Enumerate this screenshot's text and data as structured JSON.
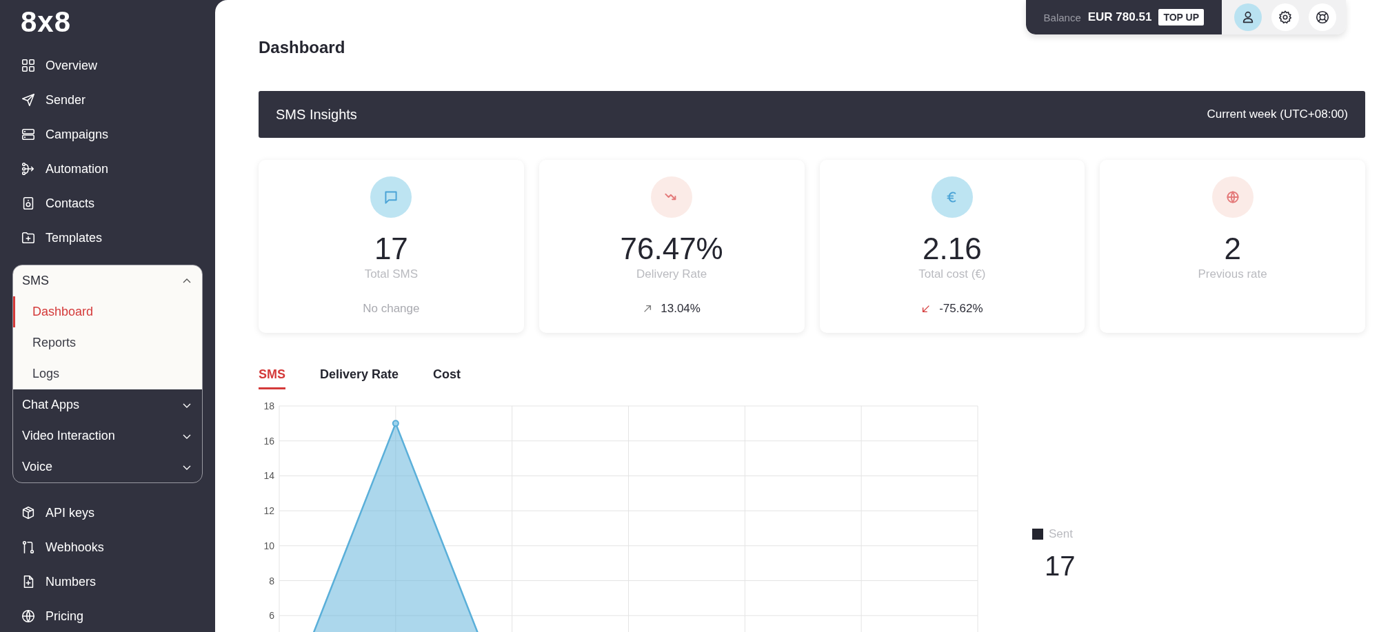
{
  "brand": {
    "logo": "8x8"
  },
  "sidebar": {
    "items_top": [
      {
        "label": "Overview",
        "kind": "grid"
      },
      {
        "label": "Sender",
        "kind": "send"
      },
      {
        "label": "Campaigns",
        "kind": "stack"
      },
      {
        "label": "Automation",
        "kind": "flow"
      },
      {
        "label": "Contacts",
        "kind": "contact"
      },
      {
        "label": "Templates",
        "kind": "folder"
      }
    ],
    "groups": [
      {
        "label": "SMS",
        "expanded": true,
        "children": [
          {
            "label": "Dashboard",
            "selected": true
          },
          {
            "label": "Reports",
            "selected": false
          },
          {
            "label": "Logs",
            "selected": false
          }
        ]
      },
      {
        "label": "Chat Apps",
        "expanded": false
      },
      {
        "label": "Video Interaction",
        "expanded": false
      },
      {
        "label": "Voice",
        "expanded": false
      }
    ],
    "items_bottom": [
      {
        "label": "API keys",
        "kind": "box"
      },
      {
        "label": "Webhooks",
        "kind": "hook"
      },
      {
        "label": "Numbers",
        "kind": "file"
      },
      {
        "label": "Pricing",
        "kind": "globe"
      }
    ]
  },
  "account": {
    "balance_label": "Balance",
    "balance": "EUR 780.51",
    "top_up": "TOP UP"
  },
  "page": {
    "title": "Dashboard"
  },
  "insights": {
    "title": "SMS Insights",
    "period": "Current week (UTC+08:00)"
  },
  "stats": [
    {
      "kind": "chat",
      "value": "17",
      "label": "Total SMS",
      "change": {
        "kind": "none",
        "text": "No change"
      }
    },
    {
      "kind": "trend",
      "value": "76.47%",
      "label": "Delivery Rate",
      "change": {
        "kind": "up",
        "text": "13.04%"
      }
    },
    {
      "kind": "euro",
      "value": "2.16",
      "label": "Total cost (€)",
      "change": {
        "kind": "down",
        "text": "-75.62%"
      }
    },
    {
      "kind": "globe",
      "value": "2",
      "label": "Previous rate"
    }
  ],
  "tabs": [
    {
      "label": "SMS",
      "selected": true
    },
    {
      "label": "Delivery Rate",
      "selected": false
    },
    {
      "label": "Cost",
      "selected": false
    }
  ],
  "chart": {
    "chart_data": {
      "type": "area",
      "grid": true,
      "series": [
        {
          "name": "Sent",
          "color": "#5aafd9",
          "values": [
            0,
            17,
            0,
            0,
            0,
            0,
            0
          ]
        }
      ],
      "ylim": [
        0,
        18
      ],
      "yticks": [
        6,
        8,
        10,
        12,
        14,
        16,
        18
      ]
    }
  },
  "legend": {
    "total": "17"
  }
}
